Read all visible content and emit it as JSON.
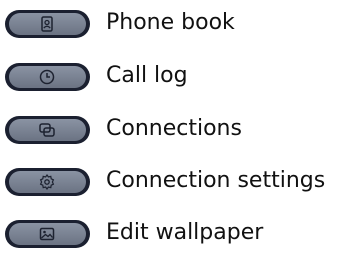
{
  "menu": {
    "items": [
      {
        "label": "Phone book",
        "icon": "phone-book-icon"
      },
      {
        "label": "Call log",
        "icon": "call-log-icon"
      },
      {
        "label": "Connections",
        "icon": "connections-icon"
      },
      {
        "label": "Connection settings",
        "icon": "settings-gear-icon"
      },
      {
        "label": "Edit wallpaper",
        "icon": "wallpaper-icon"
      }
    ]
  }
}
